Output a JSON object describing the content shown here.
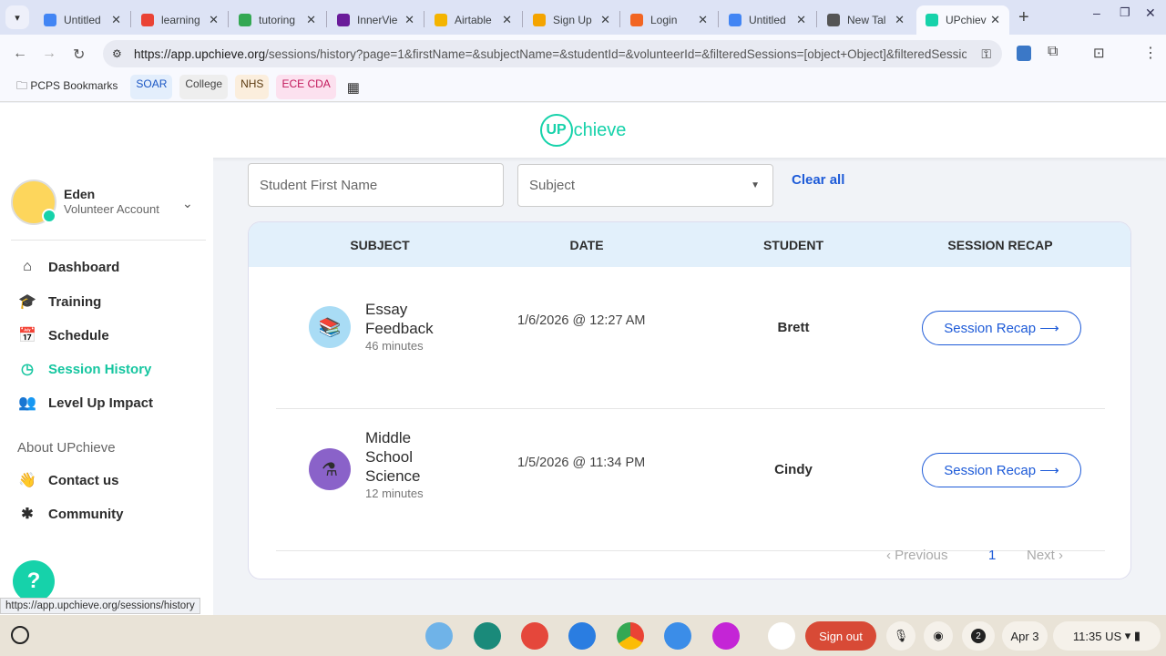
{
  "browser": {
    "tabs": [
      {
        "title": "Untitled",
        "color": "#4285f4"
      },
      {
        "title": "learning",
        "color": "#ea4335"
      },
      {
        "title": "tutoring",
        "color": "#34a853"
      },
      {
        "title": "InnerVie",
        "color": "#6a1b9a"
      },
      {
        "title": "Airtable",
        "color": "#f4b400"
      },
      {
        "title": "Sign Up",
        "color": "#f4a400"
      },
      {
        "title": "Login",
        "color": "#f26522"
      },
      {
        "title": "Untitled",
        "color": "#4285f4"
      },
      {
        "title": "New Tal",
        "color": "#555555"
      },
      {
        "title": "UPchiev",
        "color": "#16d2aa"
      }
    ],
    "url_host": "https://app.upchieve.org",
    "url_rest": "/sessions/history?page=1&firstName=&subjectName=&studentId=&volunteerId=&filteredSessions=[object+Object]&filteredSessio...",
    "bookmarks": [
      {
        "label": "PCPS Bookmarks",
        "bg": "transparent",
        "fg": "#333"
      },
      {
        "label": "SOAR",
        "bg": "#e3eefc",
        "fg": "#1a56c4"
      },
      {
        "label": "College",
        "bg": "#eeeeee",
        "fg": "#444"
      },
      {
        "label": "NHS",
        "bg": "#fbeedd",
        "fg": "#5a3a10"
      },
      {
        "label": "ECE CDA",
        "bg": "#fce1ef",
        "fg": "#c2185b"
      }
    ],
    "status_url": "https://app.upchieve.org/sessions/history"
  },
  "logo": {
    "up": "UP",
    "rest": "chieve"
  },
  "profile": {
    "name": "Eden",
    "role": "Volunteer Account"
  },
  "nav": [
    {
      "label": "Dashboard",
      "icon": "⌂"
    },
    {
      "label": "Training",
      "icon": "🎓"
    },
    {
      "label": "Schedule",
      "icon": "📅"
    },
    {
      "label": "Session History",
      "icon": "◷"
    },
    {
      "label": "Level Up Impact",
      "icon": "👥"
    }
  ],
  "about": {
    "title": "About UPchieve",
    "items": [
      {
        "label": "Contact us",
        "icon": "👋"
      },
      {
        "label": "Community",
        "icon": "✱"
      }
    ]
  },
  "filters": {
    "first_name_placeholder": "Student First Name",
    "subject_placeholder": "Subject",
    "clear": "Clear all"
  },
  "table": {
    "headers": [
      "SUBJECT",
      "DATE",
      "STUDENT",
      "SESSION RECAP"
    ],
    "rows": [
      {
        "subject": "Essay Feedback",
        "duration": "46 minutes",
        "date": "1/6/2026 @ 12:27 AM",
        "student": "Brett",
        "recap": "Session Recap ⟶"
      },
      {
        "subject": "Middle School Science",
        "duration": "12 minutes",
        "date": "1/5/2026 @ 11:34 PM",
        "student": "Cindy",
        "recap": "Session Recap ⟶"
      }
    ]
  },
  "pagination": {
    "prev": "‹ Previous",
    "page": "1",
    "next": "Next ›"
  },
  "shelf": {
    "sign_out": "Sign out",
    "notifications": "2",
    "date": "Apr 3",
    "time": "11:35 US"
  }
}
